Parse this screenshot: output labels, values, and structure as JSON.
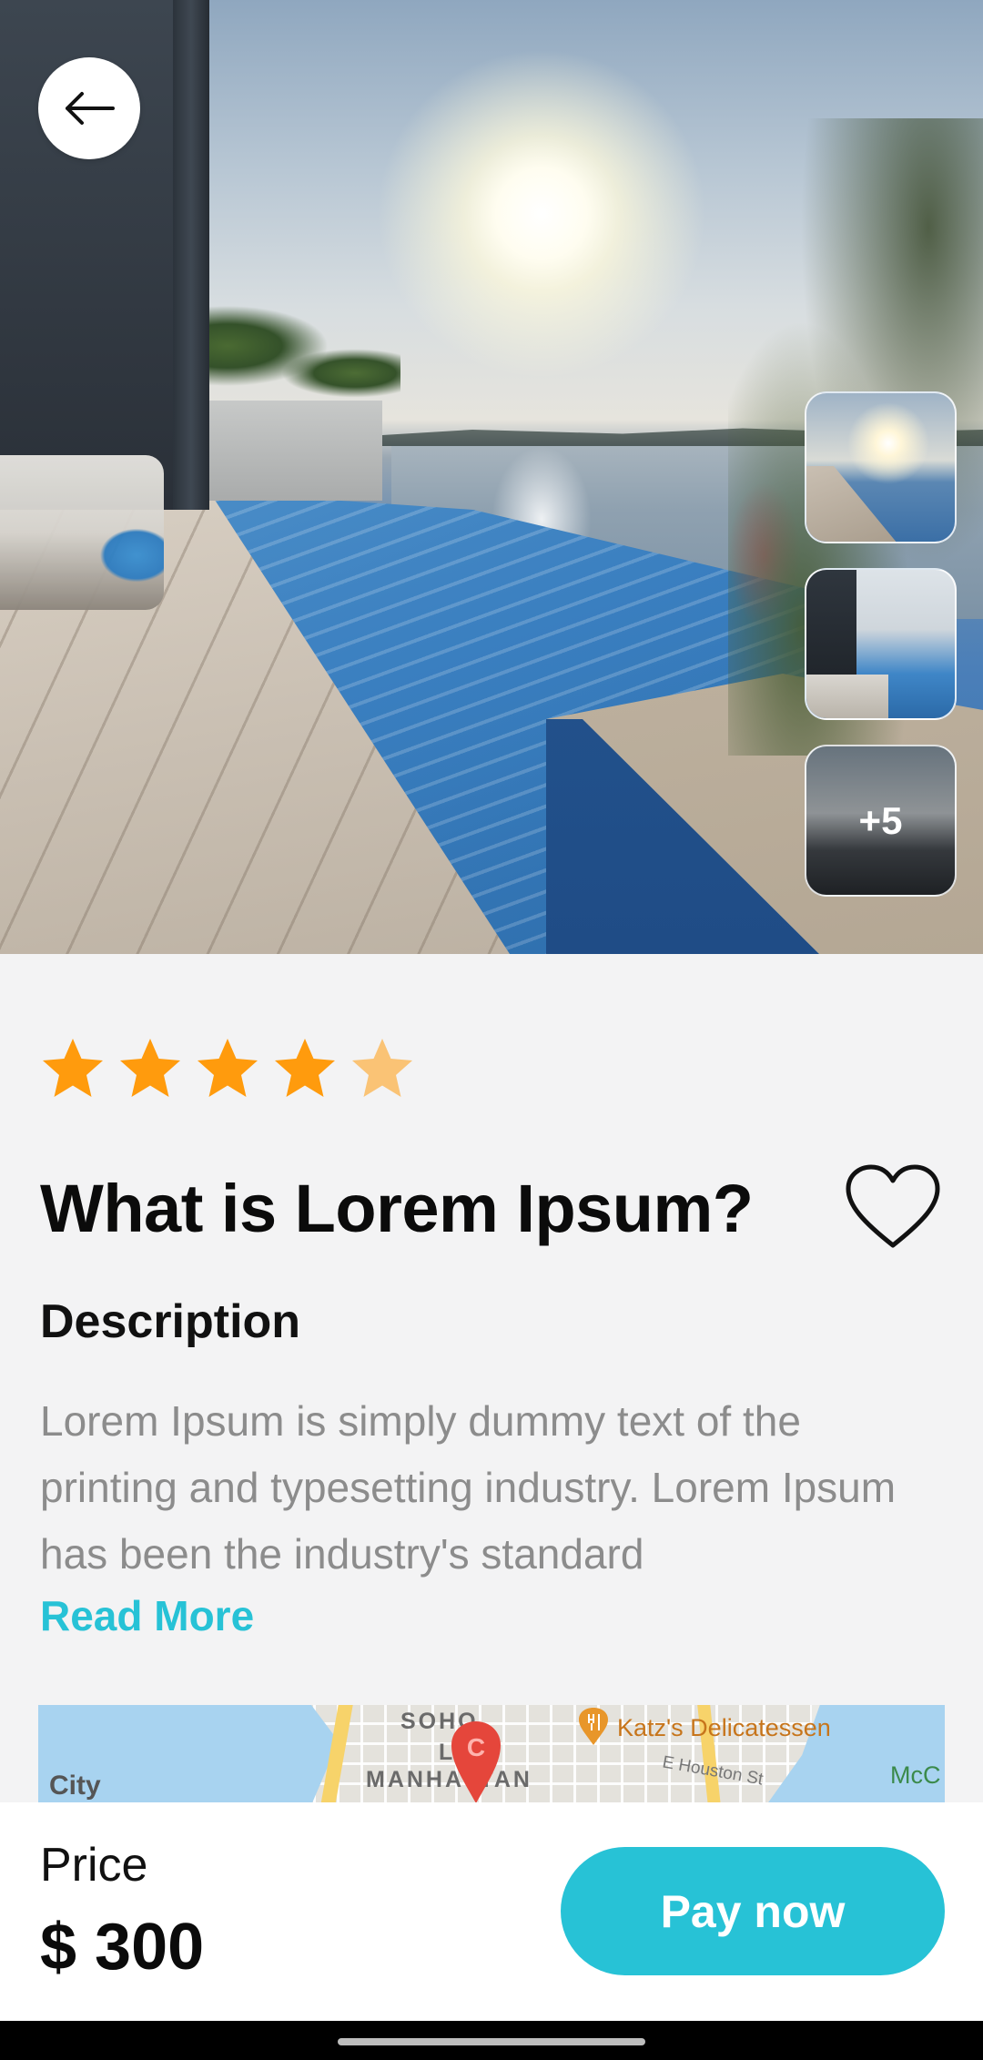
{
  "hero": {
    "back_icon": "arrow-left-icon",
    "more_photos_label": "+5"
  },
  "rating": {
    "value": 4.5,
    "max": 5,
    "color": "#ff9b0d"
  },
  "title": "What is Lorem Ipsum?",
  "favorite_icon": "heart-outline-icon",
  "description": {
    "heading": "Description",
    "text": "Lorem Ipsum is simply dummy text of the printing and typesetting industry. Lorem Ipsum has been the industry's standard",
    "read_more": "Read More"
  },
  "map": {
    "labels": {
      "city": "City",
      "soho": "SOHO",
      "lower": "LOW",
      "manhattan": "MANHATTAN",
      "katz": "Katz's Delicatessen",
      "houston": "E Houston St",
      "mcc": "McC"
    },
    "pin_letter": "C"
  },
  "checkout": {
    "price_label": "Price",
    "price_value": "$ 300",
    "pay_label": "Pay now",
    "accent": "#27c2d6"
  }
}
